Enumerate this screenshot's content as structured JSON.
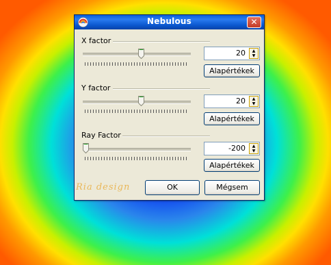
{
  "dialog": {
    "title": "Nebulous",
    "close_label": "✕"
  },
  "controls": [
    {
      "label": "X factor",
      "value": "20",
      "default_label": "Alapértékek",
      "slider_fraction": 0.52
    },
    {
      "label": "Y factor",
      "value": "20",
      "default_label": "Alapértékek",
      "slider_fraction": 0.52
    },
    {
      "label": "Ray Factor",
      "value": "-200",
      "default_label": "Alapértékek",
      "slider_fraction": 0.0
    }
  ],
  "buttons": {
    "ok": "OK",
    "cancel": "Mégsem"
  },
  "signature": "Ria design",
  "icons": {
    "spin_up": "▲",
    "spin_down": "▼"
  },
  "colors": {
    "titlebar": "#0a5fd6",
    "dialog_bg": "#ece9d8",
    "close": "#c33a25"
  }
}
